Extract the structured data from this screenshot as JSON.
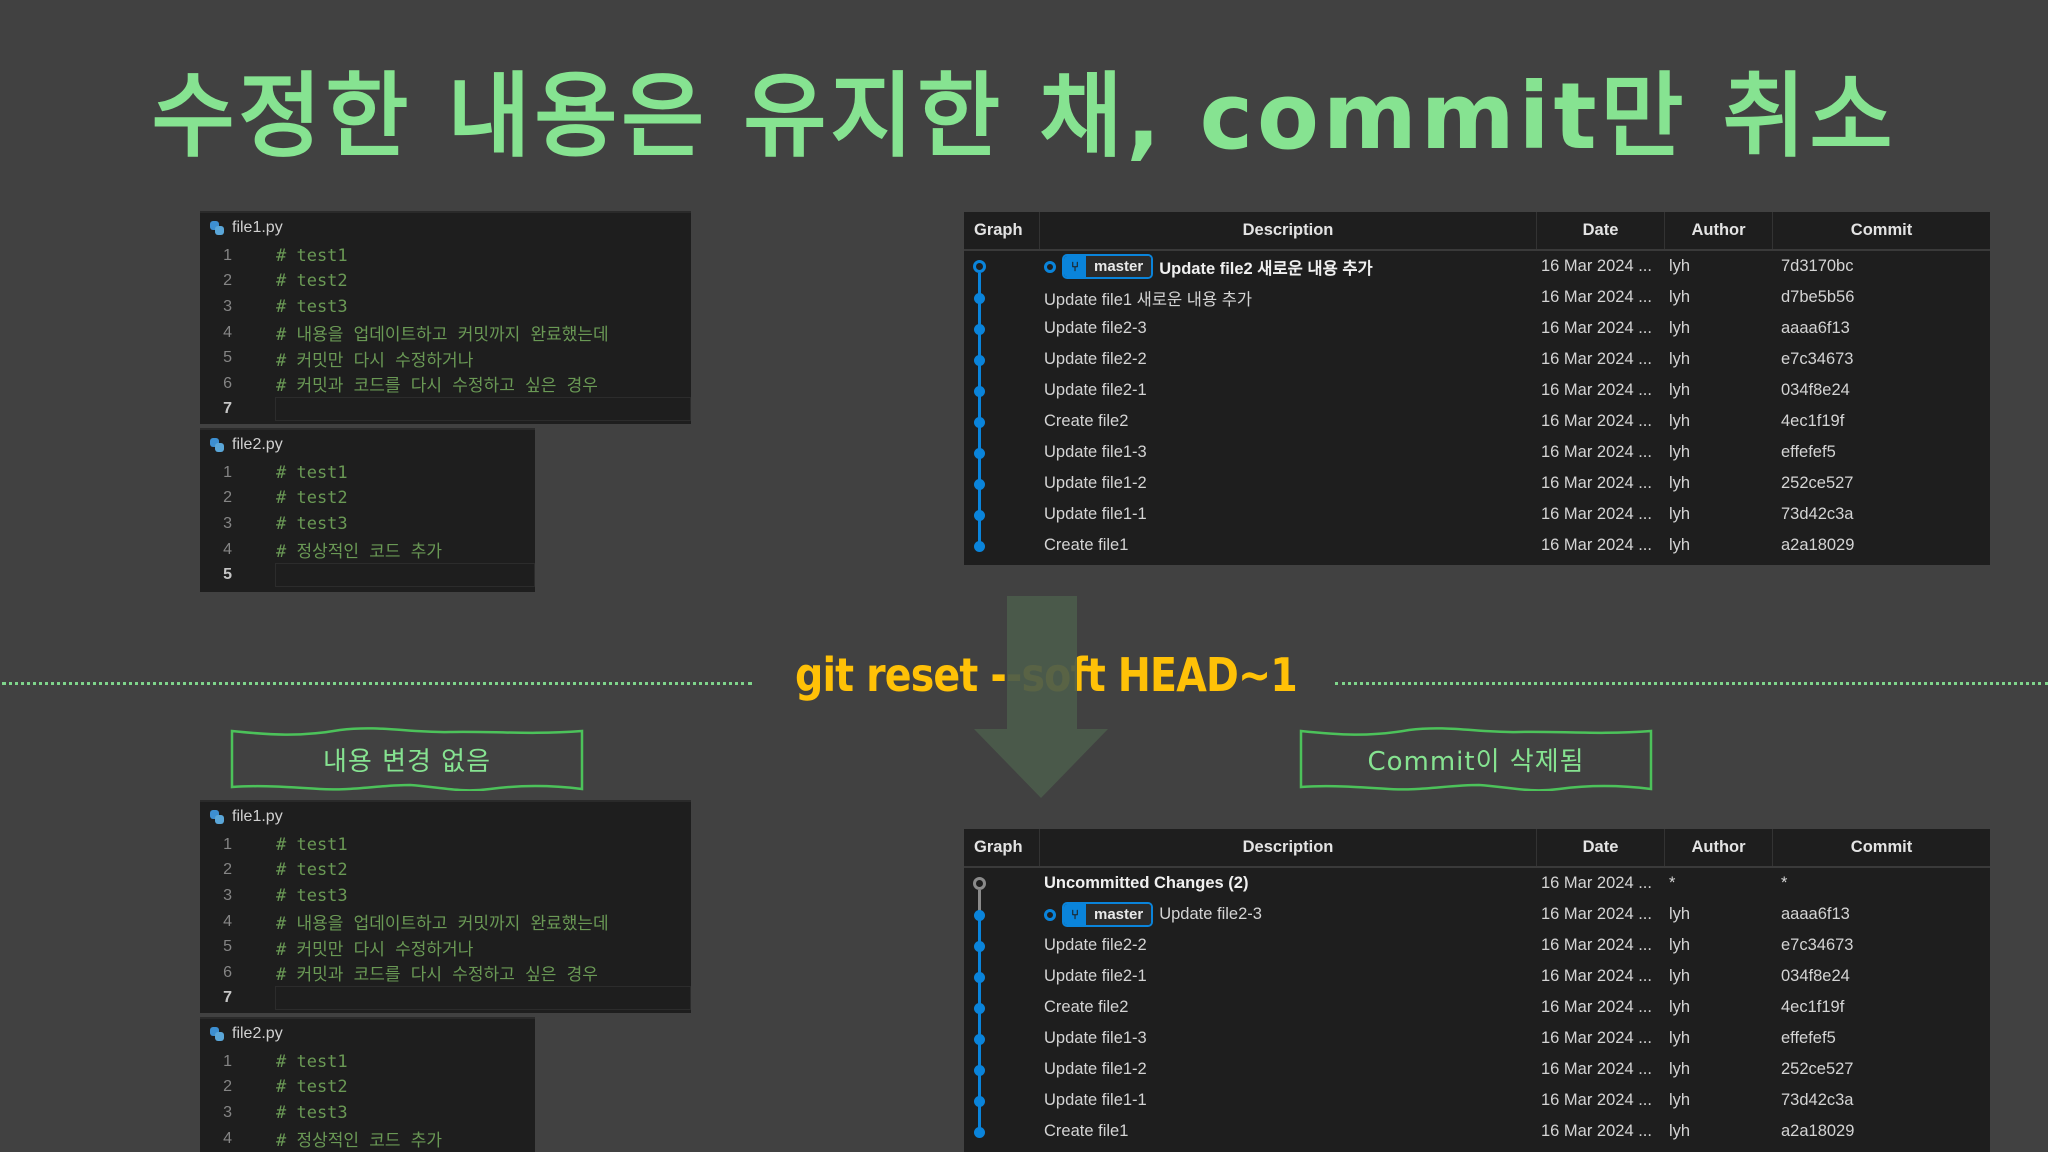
{
  "title": "수정한 내용은 유지한 채, commit만 취소",
  "command": "git reset --soft HEAD~1",
  "notes": {
    "left": "내용 변경 없음",
    "right": "Commit이 삭제됨"
  },
  "colors": {
    "background": "#414141",
    "title": "#86e391",
    "command": "#ffc107",
    "comment": "#6a9955",
    "graph": "#0a84db",
    "arrow": "#4b5b4b"
  },
  "before": {
    "file1": {
      "filename": "file1.py",
      "lines": [
        {
          "num": "1",
          "text": "# test1"
        },
        {
          "num": "2",
          "text": "# test2"
        },
        {
          "num": "3",
          "text": "# test3"
        },
        {
          "num": "4",
          "text": "# 내용을 업데이트하고 커밋까지 완료했는데"
        },
        {
          "num": "5",
          "text": "# 커밋만 다시 수정하거나"
        },
        {
          "num": "6",
          "text": "# 커밋과 코드를 다시 수정하고 싶은 경우"
        },
        {
          "num": "7",
          "text": ""
        }
      ]
    },
    "file2": {
      "filename": "file2.py",
      "lines": [
        {
          "num": "1",
          "text": "# test1"
        },
        {
          "num": "2",
          "text": "# test2"
        },
        {
          "num": "3",
          "text": "# test3"
        },
        {
          "num": "4",
          "text": "# 정상적인 코드 추가"
        },
        {
          "num": "5",
          "text": ""
        }
      ]
    },
    "git": {
      "headers": {
        "graph": "Graph",
        "description": "Description",
        "date": "Date",
        "author": "Author",
        "commit": "Commit"
      },
      "branch": "master",
      "rows": [
        {
          "description": "Update file2 새로운 내용 추가",
          "date": "16 Mar 2024 ...",
          "author": "lyh",
          "commit": "7d3170bc"
        },
        {
          "description": "Update file1 새로운 내용 추가",
          "date": "16 Mar 2024 ...",
          "author": "lyh",
          "commit": "d7be5b56"
        },
        {
          "description": "Update file2-3",
          "date": "16 Mar 2024 ...",
          "author": "lyh",
          "commit": "aaaa6f13"
        },
        {
          "description": "Update file2-2",
          "date": "16 Mar 2024 ...",
          "author": "lyh",
          "commit": "e7c34673"
        },
        {
          "description": "Update file2-1",
          "date": "16 Mar 2024 ...",
          "author": "lyh",
          "commit": "034f8e24"
        },
        {
          "description": "Create file2",
          "date": "16 Mar 2024 ...",
          "author": "lyh",
          "commit": "4ec1f19f"
        },
        {
          "description": "Update file1-3",
          "date": "16 Mar 2024 ...",
          "author": "lyh",
          "commit": "effefef5"
        },
        {
          "description": "Update file1-2",
          "date": "16 Mar 2024 ...",
          "author": "lyh",
          "commit": "252ce527"
        },
        {
          "description": "Update file1-1",
          "date": "16 Mar 2024 ...",
          "author": "lyh",
          "commit": "73d42c3a"
        },
        {
          "description": "Create file1",
          "date": "16 Mar 2024 ...",
          "author": "lyh",
          "commit": "a2a18029"
        }
      ]
    }
  },
  "after": {
    "file1": {
      "filename": "file1.py",
      "lines": [
        {
          "num": "1",
          "text": "# test1"
        },
        {
          "num": "2",
          "text": "# test2"
        },
        {
          "num": "3",
          "text": "# test3"
        },
        {
          "num": "4",
          "text": "# 내용을 업데이트하고 커밋까지 완료했는데"
        },
        {
          "num": "5",
          "text": "# 커밋만 다시 수정하거나"
        },
        {
          "num": "6",
          "text": "# 커밋과 코드를 다시 수정하고 싶은 경우"
        },
        {
          "num": "7",
          "text": ""
        }
      ]
    },
    "file2": {
      "filename": "file2.py",
      "lines": [
        {
          "num": "1",
          "text": "# test1"
        },
        {
          "num": "2",
          "text": "# test2"
        },
        {
          "num": "3",
          "text": "# test3"
        },
        {
          "num": "4",
          "text": "# 정상적인 코드 추가"
        }
      ]
    },
    "git": {
      "headers": {
        "graph": "Graph",
        "description": "Description",
        "date": "Date",
        "author": "Author",
        "commit": "Commit"
      },
      "branch": "master",
      "rows": [
        {
          "description": "Uncommitted Changes (2)",
          "date": "16 Mar 2024 ...",
          "author": "*",
          "commit": "*"
        },
        {
          "description": "Update file2-3",
          "date": "16 Mar 2024 ...",
          "author": "lyh",
          "commit": "aaaa6f13"
        },
        {
          "description": "Update file2-2",
          "date": "16 Mar 2024 ...",
          "author": "lyh",
          "commit": "e7c34673"
        },
        {
          "description": "Update file2-1",
          "date": "16 Mar 2024 ...",
          "author": "lyh",
          "commit": "034f8e24"
        },
        {
          "description": "Create file2",
          "date": "16 Mar 2024 ...",
          "author": "lyh",
          "commit": "4ec1f19f"
        },
        {
          "description": "Update file1-3",
          "date": "16 Mar 2024 ...",
          "author": "lyh",
          "commit": "effefef5"
        },
        {
          "description": "Update file1-2",
          "date": "16 Mar 2024 ...",
          "author": "lyh",
          "commit": "252ce527"
        },
        {
          "description": "Update file1-1",
          "date": "16 Mar 2024 ...",
          "author": "lyh",
          "commit": "73d42c3a"
        },
        {
          "description": "Create file1",
          "date": "16 Mar 2024 ...",
          "author": "lyh",
          "commit": "a2a18029"
        }
      ]
    }
  }
}
